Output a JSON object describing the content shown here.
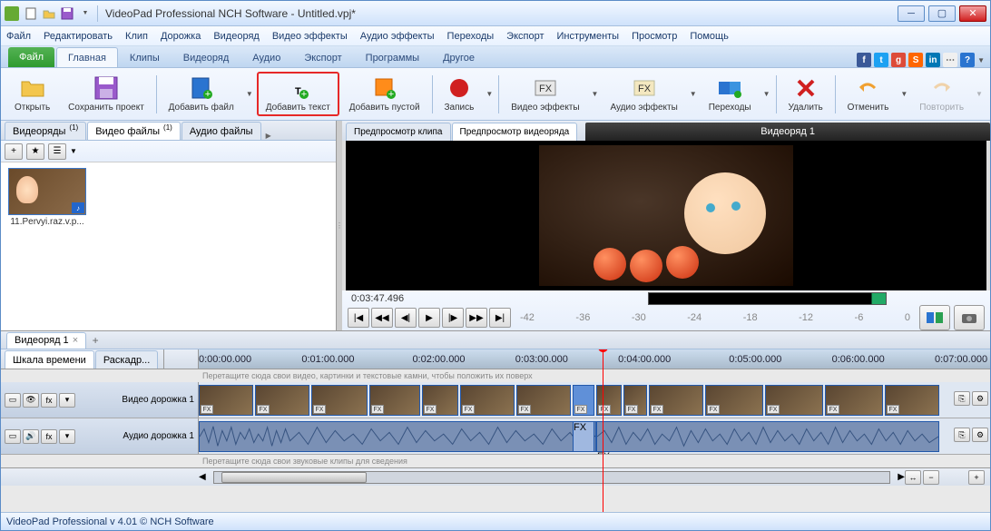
{
  "title": "VideoPad Professional NCH Software - Untitled.vpj*",
  "menu": [
    "Файл",
    "Редактировать",
    "Клип",
    "Дорожка",
    "Видеоряд",
    "Видео эффекты",
    "Аудио эффекты",
    "Переходы",
    "Экспорт",
    "Инструменты",
    "Просмотр",
    "Помощь"
  ],
  "ribbon_tabs": {
    "file": "Файл",
    "items": [
      "Главная",
      "Клипы",
      "Видеоряд",
      "Аудио",
      "Экспорт",
      "Программы",
      "Другое"
    ],
    "active": 0
  },
  "ribbon": {
    "open": "Открыть",
    "save": "Сохранить проект",
    "add_file": "Добавить файл",
    "add_text": "Добавить текст",
    "add_blank": "Добавить пустой",
    "record": "Запись",
    "video_fx": "Видео эффекты",
    "audio_fx": "Аудио эффекты",
    "transitions": "Переходы",
    "delete": "Удалить",
    "undo": "Отменить",
    "redo": "Повторить"
  },
  "bins": {
    "tabs": [
      {
        "label": "Видеоряды",
        "count": "(1)"
      },
      {
        "label": "Видео файлы",
        "count": "(1)"
      },
      {
        "label": "Аудио файлы",
        "count": ""
      }
    ],
    "active": 1,
    "clip": {
      "name": "11.Pervyi.raz.v.p..."
    }
  },
  "preview": {
    "tabs": [
      "Предпросмотр клипа",
      "Предпросмотр видеоряда"
    ],
    "active": 1,
    "title": "Видеоряд 1",
    "timecode": "0:03:47.496",
    "slider_ticks": [
      "-42",
      "-36",
      "-30",
      "-24",
      "-18",
      "-12",
      "-6",
      "0"
    ]
  },
  "sequence_tab": "Видеоряд 1",
  "timeline": {
    "mode_tabs": [
      "Шкала времени",
      "Раскадр..."
    ],
    "ruler": [
      "0:00:00.000",
      "0:01:00.000",
      "0:02:00.000",
      "0:03:00.000",
      "0:04:00.000",
      "0:05:00.000",
      "0:06:00.000",
      "0:07:00.000"
    ],
    "drag_hint_1": "Перетащите сюда свои видео, картинки и текстовые камни, чтобы положить их поверх",
    "video_track": "Видео дорожка 1",
    "audio_track": "Аудио дорожка 1",
    "drag_hint_2": "Перетащите сюда свои звуковые клипы для сведения",
    "fx_label": "FX"
  },
  "status": "VideoPad Professional v 4.01  © NCH Software"
}
